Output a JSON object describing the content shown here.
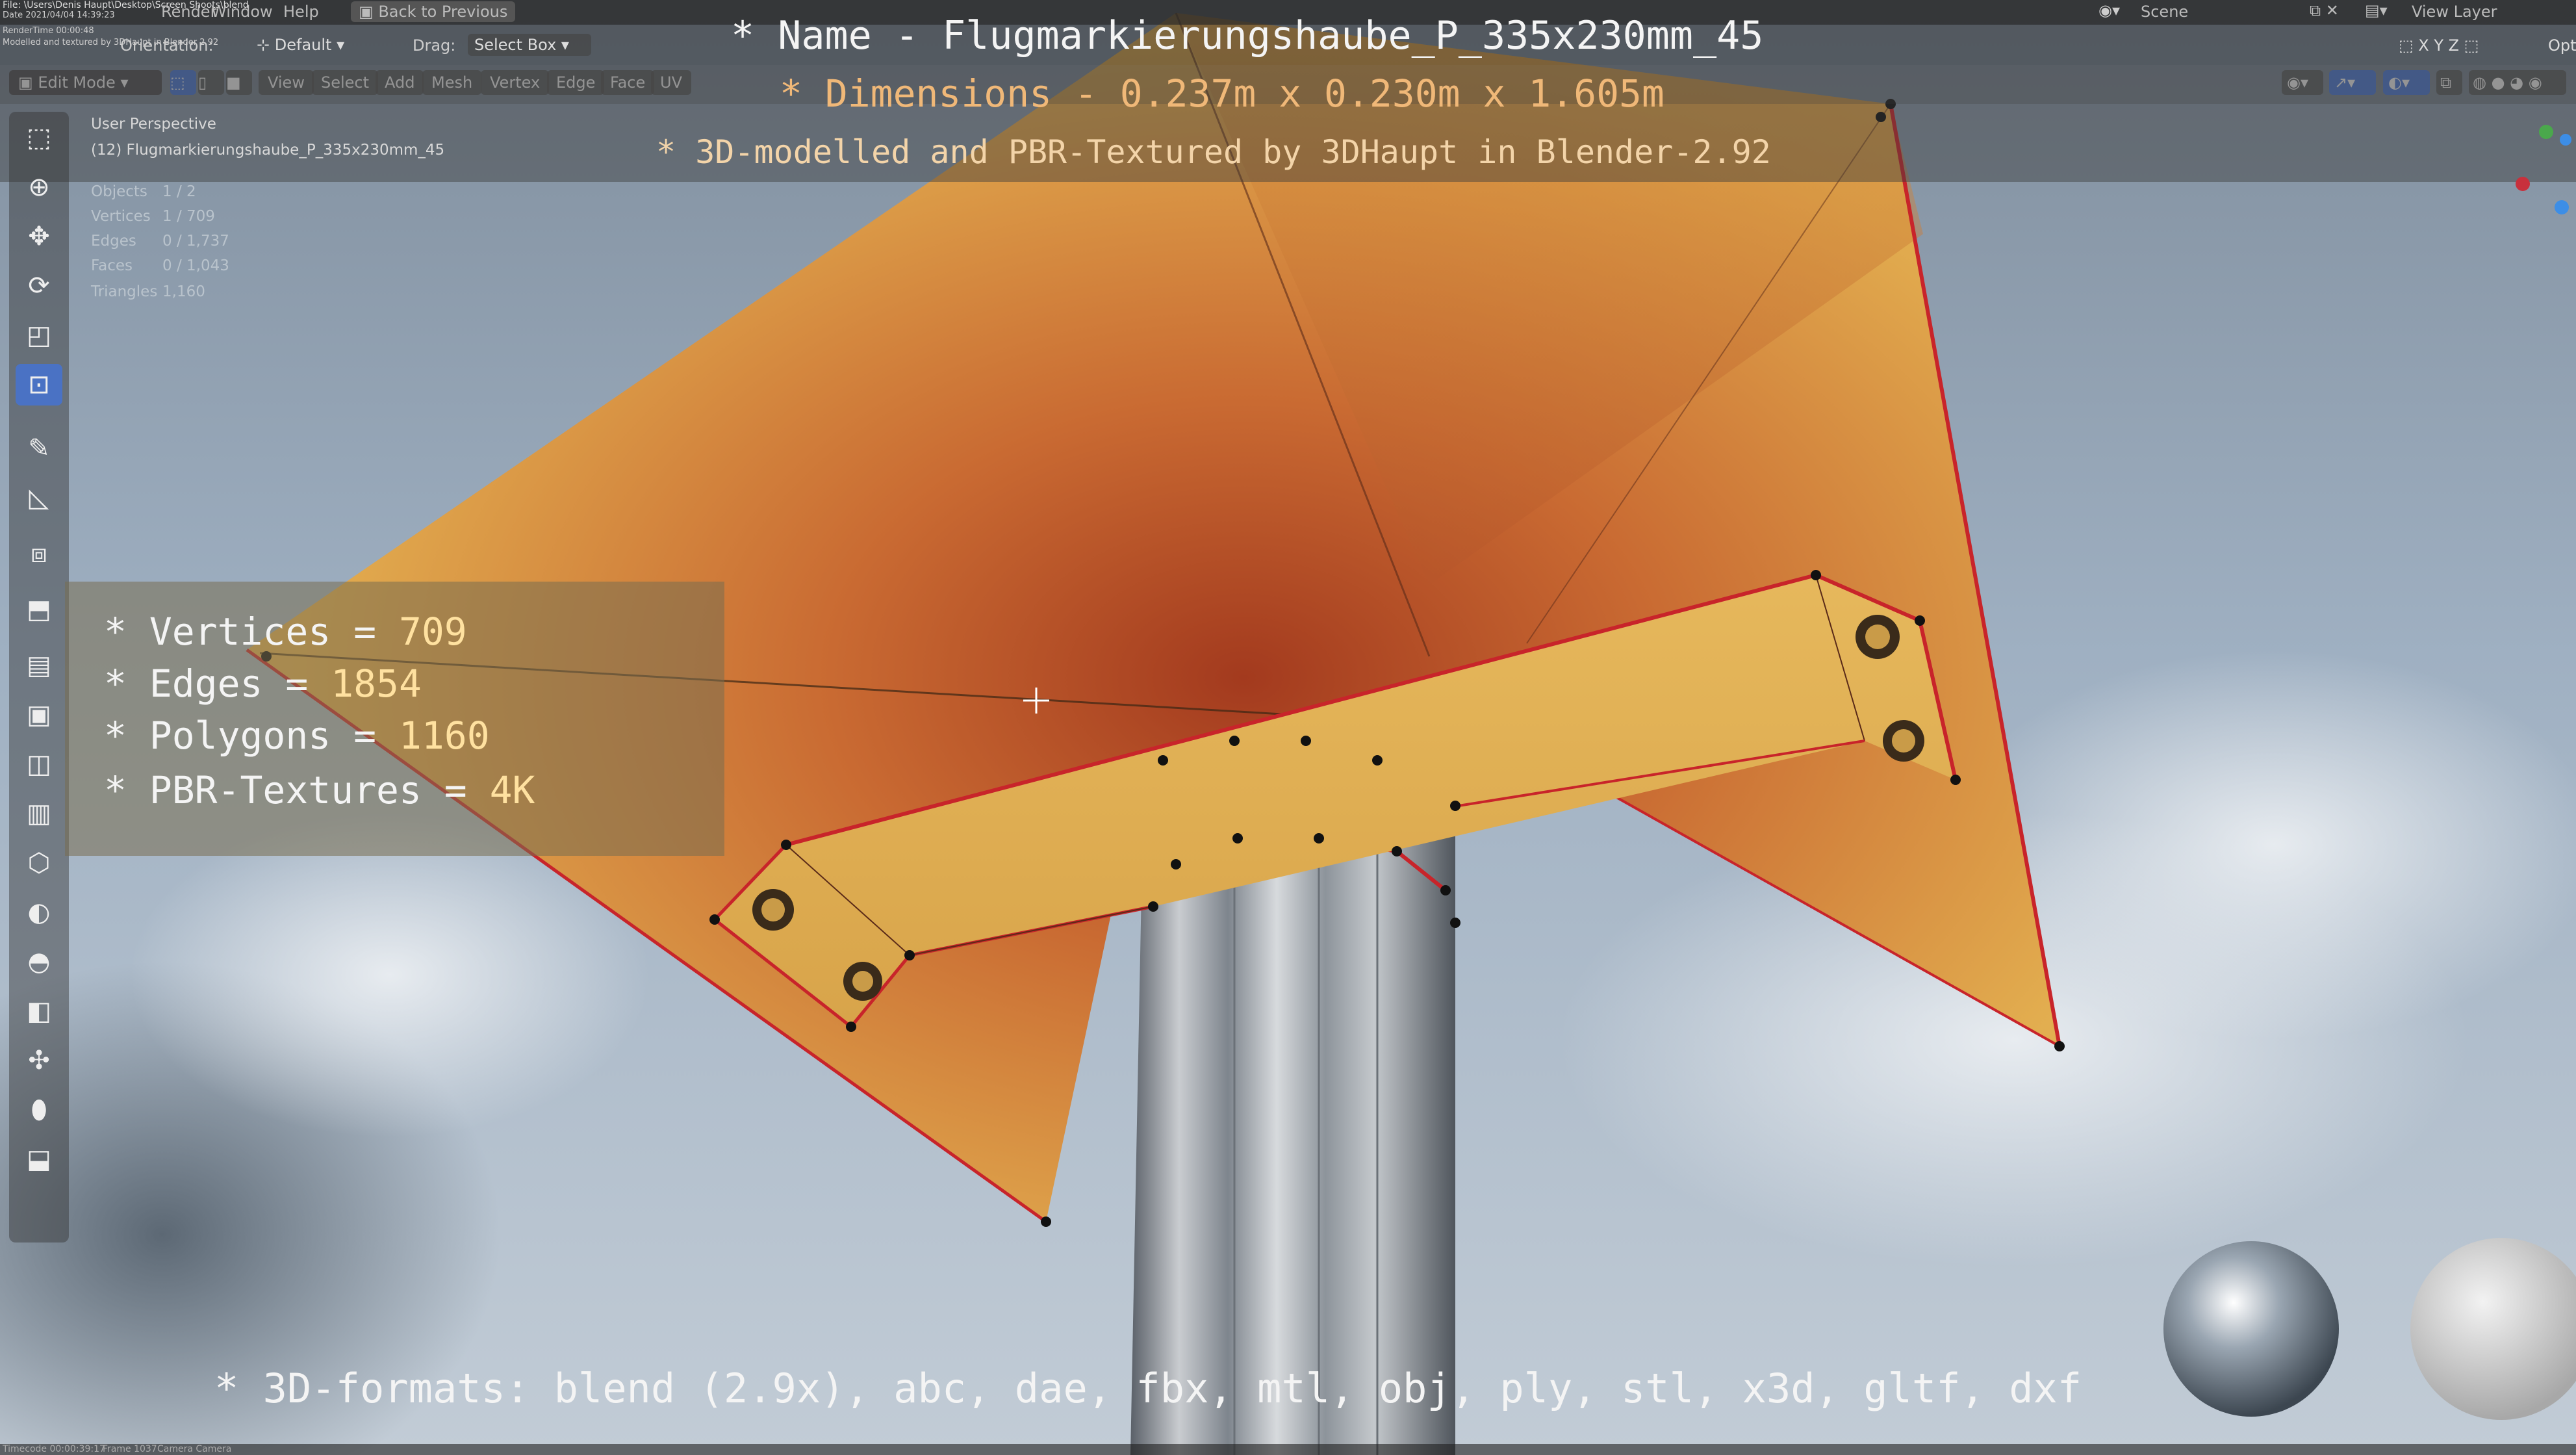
{
  "topbar": {
    "file_path": "File: \\Users\\Denis Haupt\\Desktop\\Screen Shoots\\blend",
    "date": "Date 2021/04/04 14:39:23",
    "render_time": "RenderTime 00:00:48",
    "menu_render": "Render",
    "menu_window": "Window",
    "menu_help": "Help",
    "back_button": "Back to Previous",
    "scene_label": "Scene",
    "view_layer_label": "View Layer",
    "modelled_note": "Modelled and textured by 3DHaupt in Blender 2.92"
  },
  "header": {
    "orientation_label": "Orientation:",
    "orientation_value": "Default",
    "drag_label": "Drag:",
    "drag_value": "Select Box",
    "mode": "Edit Mode",
    "menus": [
      "View",
      "Select",
      "Add",
      "Mesh",
      "Vertex",
      "Edge",
      "Face",
      "UV"
    ],
    "options_label": "Opti"
  },
  "viewport_info": {
    "perspective": "User Perspective",
    "object_name": "(12) Flugmarkierungshaube_P_335x230mm_45",
    "stats": [
      {
        "label": "Objects",
        "value": "1 / 2"
      },
      {
        "label": "Vertices",
        "value": "1 / 709"
      },
      {
        "label": "Edges",
        "value": "0 / 1,737"
      },
      {
        "label": "Faces",
        "value": "0 / 1,043"
      },
      {
        "label": "Triangles",
        "value": "1,160"
      }
    ]
  },
  "overlay": {
    "name_line": "* Name - Flugmarkierungshaube_P_335x230mm_45",
    "dimensions_line": "* Dimensions -  0.237m x 0.230m x 1.605m",
    "modelled_line": "* 3D-modelled and PBR-Textured by 3DHaupt in Blender-2.92",
    "formats_line": "* 3D-formats: blend (2.9x), abc, dae, fbx, mtl, obj, ply, stl, x3d, gltf, dxf",
    "stats": [
      {
        "label": "* Vertices = ",
        "value": "709"
      },
      {
        "label": "* Edges = ",
        "value": "1854"
      },
      {
        "label": "* Polygons = ",
        "value": "1160"
      },
      {
        "label": "* PBR-Textures = ",
        "value": "4K"
      }
    ]
  },
  "footer": {
    "timecode": "Timecode 00:00:39:17",
    "frame": "Frame 1037",
    "camera": "Camera Camera"
  },
  "colors": {
    "accent_blue": "#4a72c4",
    "plate_yellow": "#e2ad4f",
    "plate_orange": "#b45a2a",
    "edge_red": "#c8242a",
    "sky": "#aab7c4"
  },
  "icons": {
    "toolbar": [
      "select-box-icon",
      "cursor-icon",
      "move-icon",
      "rotate-icon",
      "scale-icon",
      "transform-icon",
      "annotate-icon",
      "measure-icon",
      "add-cube-icon",
      "extrude-icon",
      "inset-icon",
      "bevel-icon",
      "loop-cut-icon",
      "knife-icon",
      "poly-build-icon",
      "spin-icon",
      "smooth-icon",
      "edge-slide-icon",
      "shrink-icon",
      "shear-icon",
      "rip-icon"
    ]
  }
}
